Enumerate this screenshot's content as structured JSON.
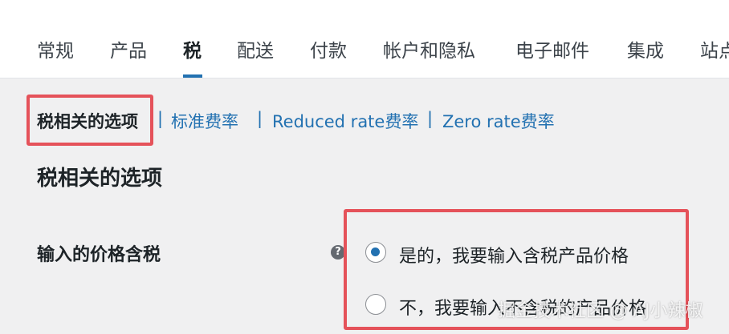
{
  "tabs": [
    {
      "label": "常规"
    },
    {
      "label": "产品"
    },
    {
      "label": "税"
    },
    {
      "label": "配送"
    },
    {
      "label": "付款"
    },
    {
      "label": "帐户和隐私"
    },
    {
      "label": "电子邮件"
    },
    {
      "label": "集成"
    },
    {
      "label": "站点"
    }
  ],
  "subnav": {
    "current": "税相关的选项",
    "separator": "|",
    "standard": "标准费率",
    "reduced": "Reduced rate费率",
    "zero": "Zero rate费率"
  },
  "section": {
    "title": "税相关的选项"
  },
  "field": {
    "label": "输入的价格含税",
    "help_icon": "?",
    "options": [
      {
        "label": "是的，我要输入含税产品价格",
        "checked": true
      },
      {
        "label": "不，我要输入不含税的产品价格",
        "checked": false
      }
    ]
  },
  "watermark": "掘金技术社区 @ AJ小辣椒",
  "colors": {
    "accent": "#2271b1",
    "highlight_box": "#e5525a"
  }
}
